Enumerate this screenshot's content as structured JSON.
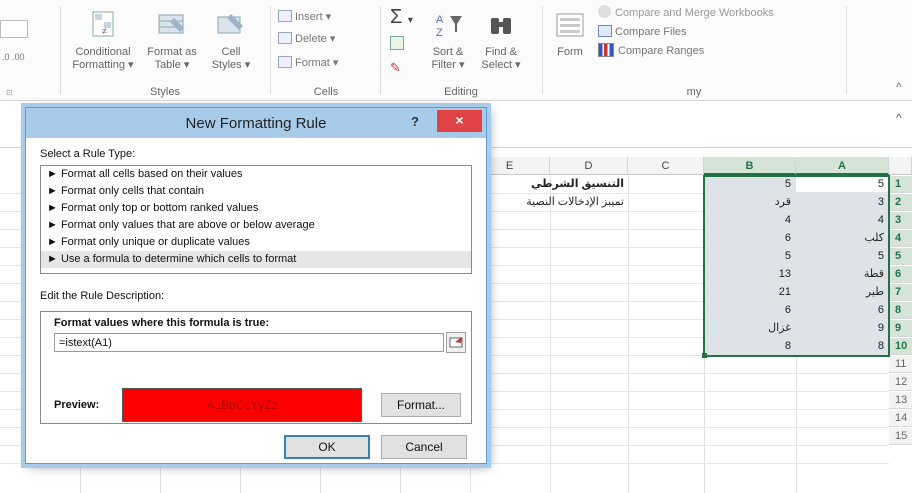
{
  "ribbon": {
    "styles": {
      "group_label": "Styles",
      "conditional_formatting_line1": "Conditional",
      "conditional_formatting_line2": "Formatting",
      "format_as_table_line1": "Format as",
      "format_as_table_line2": "Table",
      "cell_styles_line1": "Cell",
      "cell_styles_line2": "Styles"
    },
    "cells": {
      "group_label": "Cells",
      "insert": "Insert",
      "delete": "Delete",
      "format": "Format"
    },
    "editing": {
      "group_label": "Editing",
      "sort_filter_line1": "Sort &",
      "sort_filter_line2": "Filter",
      "find_select_line1": "Find &",
      "find_select_line2": "Select"
    },
    "my": {
      "group_label": "my",
      "form": "Form",
      "compare_merge": "Compare and Merge Workbooks",
      "compare_files": "Compare Files",
      "compare_ranges": "Compare Ranges"
    }
  },
  "dialog": {
    "title": "New Formatting Rule",
    "help": "?",
    "close": "×",
    "select_rule_type_label": "Select a Rule Type:",
    "rule_types": [
      "► Format all cells based on their values",
      "► Format only cells that contain",
      "► Format only top or bottom ranked values",
      "► Format only values that are above or below average",
      "► Format only unique or duplicate values",
      "► Use a formula to determine which cells to format"
    ],
    "edit_description_label": "Edit the Rule Description:",
    "formula_label": "Format values where this formula is true:",
    "formula_value": "=istext(A1)",
    "preview_label": "Preview:",
    "preview_sample": "AaBbCcYyZz",
    "format_button": "Format...",
    "ok_button": "OK",
    "cancel_button": "Cancel"
  },
  "sheet": {
    "columns": [
      "E",
      "D",
      "C",
      "B",
      "A"
    ],
    "rows": [
      "1",
      "2",
      "3",
      "4",
      "5",
      "6",
      "7",
      "8",
      "9",
      "10",
      "11",
      "12",
      "13",
      "14",
      "15"
    ],
    "d1": "التنسيق الشرطي",
    "d2": "تميبز الإدخالات النصية",
    "col_a": [
      "5",
      "3",
      "4",
      "كلب",
      "5",
      "قطة",
      "طير",
      "6",
      "9",
      "8"
    ],
    "col_b": [
      "5",
      "قرد",
      "4",
      "6",
      "5",
      "13",
      "21",
      "6",
      "غزال",
      "8"
    ],
    "selection_color": "#217346",
    "preview_fill": "#ff0000"
  }
}
